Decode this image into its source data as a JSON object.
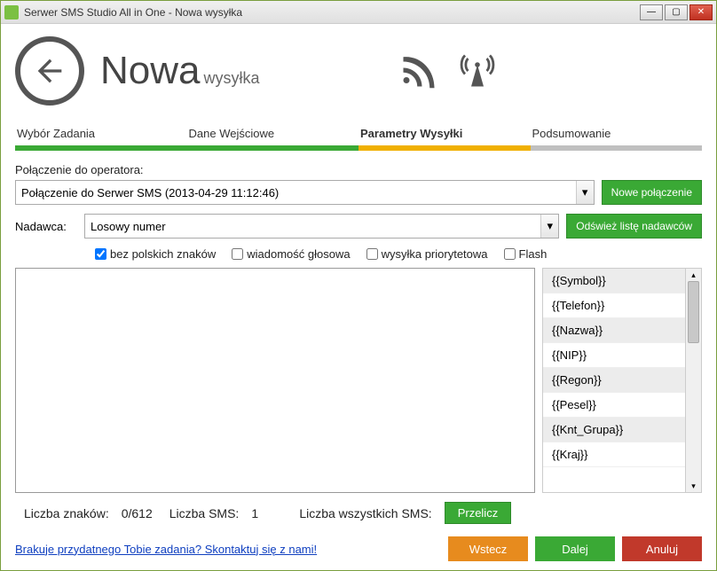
{
  "window": {
    "title": "Serwer SMS Studio All in One - Nowa wysyłka"
  },
  "header": {
    "title_main": "Nowa",
    "title_sub": "wysyłka"
  },
  "steps": [
    {
      "label": "Wybór Zadania",
      "state": "done"
    },
    {
      "label": "Dane Wejściowe",
      "state": "done"
    },
    {
      "label": "Parametry Wysyłki",
      "state": "current"
    },
    {
      "label": "Podsumowanie",
      "state": "todo"
    }
  ],
  "connection": {
    "label": "Połączenie do operatora:",
    "selected": "Połączenie do Serwer SMS (2013-04-29 11:12:46)",
    "new_button": "Nowe połączenie"
  },
  "sender": {
    "label": "Nadawca:",
    "selected": "Losowy numer",
    "refresh_button": "Odśwież listę nadawców"
  },
  "options": {
    "no_polish": "bez polskich znaków",
    "voice": "wiadomość głosowa",
    "priority": "wysyłka priorytetowa",
    "flash": "Flash",
    "no_polish_checked": true,
    "voice_checked": false,
    "priority_checked": false,
    "flash_checked": false
  },
  "message": {
    "text": ""
  },
  "placeholders": [
    "{{Symbol}}",
    "{{Telefon}}",
    "{{Nazwa}}",
    "{{NIP}}",
    "{{Regon}}",
    "{{Pesel}}",
    "{{Knt_Grupa}}",
    "{{Kraj}}"
  ],
  "counts": {
    "chars_label": "Liczba znaków:",
    "chars_value": "0/612",
    "sms_label": "Liczba SMS:",
    "sms_value": "1",
    "total_label": "Liczba wszystkich SMS:",
    "calc_button": "Przelicz"
  },
  "footer": {
    "link": "Brakuje przydatnego Tobie zadania? Skontaktuj się z nami!",
    "back": "Wstecz",
    "next": "Dalej",
    "cancel": "Anuluj"
  }
}
